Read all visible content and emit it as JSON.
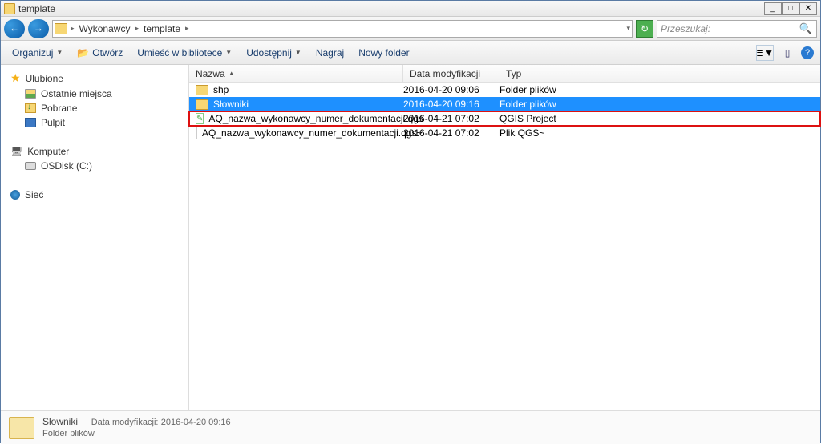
{
  "window": {
    "title": "template"
  },
  "nav": {
    "crumbs": [
      "Wykonawcy",
      "template"
    ],
    "search_placeholder": "Przeszukaj:"
  },
  "toolbar": {
    "organize": "Organizuj",
    "open": "Otwórz",
    "library": "Umieść w bibliotece",
    "share": "Udostępnij",
    "burn": "Nagraj",
    "newfolder": "Nowy folder"
  },
  "sidebar": {
    "favorites": "Ulubione",
    "recent": "Ostatnie miejsca",
    "downloads": "Pobrane",
    "desktop": "Pulpit",
    "computer": "Komputer",
    "osdisk": "OSDisk (C:)",
    "network": "Sieć"
  },
  "columns": {
    "name": "Nazwa",
    "date": "Data modyfikacji",
    "type": "Typ"
  },
  "rows": [
    {
      "name": "shp",
      "date": "2016-04-20 09:06",
      "type": "Folder plików",
      "icon": "folder"
    },
    {
      "name": "Słowniki",
      "date": "2016-04-20 09:16",
      "type": "Folder plików",
      "icon": "folder",
      "selected": true
    },
    {
      "name": "AQ_nazwa_wykonawcy_numer_dokumentacji.qgs",
      "date": "2016-04-21 07:02",
      "type": "QGIS Project",
      "icon": "qgs",
      "highlighted": true
    },
    {
      "name": "AQ_nazwa_wykonawcy_numer_dokumentacji.qgs~",
      "date": "2016-04-21 07:02",
      "type": "Plik QGS~",
      "icon": "file"
    }
  ],
  "status": {
    "name": "Słowniki",
    "meta_label": "Data modyfikacji:",
    "meta_value": "2016-04-20 09:16",
    "sub": "Folder plików"
  }
}
